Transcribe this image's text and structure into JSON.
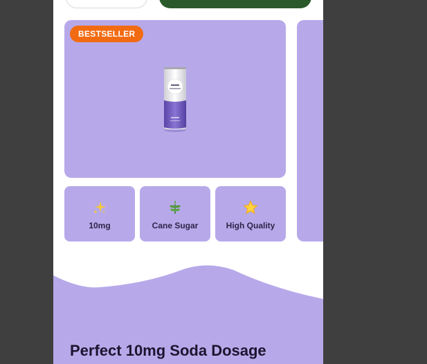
{
  "product_card": {
    "badge": "BESTSELLER",
    "image": "purple-soda-can",
    "can_brand": "looner"
  },
  "features": [
    {
      "icon": "sparkles-icon",
      "label": "10mg"
    },
    {
      "icon": "herb-leaf-icon",
      "label": "Cane Sugar"
    },
    {
      "icon": "star-icon",
      "label": "High Quality"
    }
  ],
  "section": {
    "title": "Perfect 10mg Soda Dosage"
  },
  "colors": {
    "card_purple": "#b7a9e9",
    "badge_orange": "#f26b12",
    "cta_green": "#2a5a2b"
  }
}
